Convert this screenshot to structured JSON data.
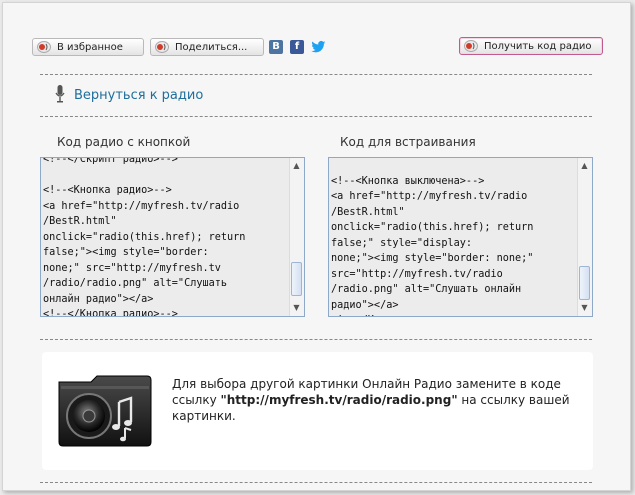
{
  "toolbar": {
    "favorites_label": "В избранное",
    "share_label": "Поделиться...",
    "get_code_label": "Получить код радио",
    "social": {
      "vk": "B",
      "facebook": "f",
      "twitter": "twitter-icon"
    }
  },
  "nav": {
    "back_label": "Вернуться к радио"
  },
  "code_panels": [
    {
      "title": "Код радио с кнопкой",
      "code": "<!--</Скрипт радио>-->\n\n<!--<Кнопка радио>-->\n<a href=\"http://myfresh.tv/radio\n/BestR.html\"\nonclick=\"radio(this.href); return\nfalse;\"><img style=\"border:\nnone;\" src=\"http://myfresh.tv\n/radio/radio.png\" alt=\"Слушать\nонлайн радио\"></a>\n<!--</Кнопка радио>-->"
    },
    {
      "title": "Код для встраивания",
      "code": "\n<!--<Кнопка выключена>-->\n<a href=\"http://myfresh.tv/radio\n/BestR.html\"\nonclick=\"radio(this.href); return\nfalse;\" style=\"display:\nnone;\"><img style=\"border: none;\"\nsrc=\"http://myfresh.tv/radio\n/radio.png\" alt=\"Слушать онлайн\nрадио\"></a>\n<!--</Кнопка выключена>-->"
    }
  ],
  "info": {
    "text_before": "Для выбора другой картинки Онлайн Радио замените в коде ссылку ",
    "link": "\"http://myfresh.tv/radio/radio.png\"",
    "text_after": " на ссылку вашей картинки."
  },
  "colors": {
    "link": "#1f6e9c",
    "accent": "#c25a8e",
    "vk": "#4c75a3",
    "facebook": "#3b5998",
    "twitter": "#1da1f2"
  }
}
